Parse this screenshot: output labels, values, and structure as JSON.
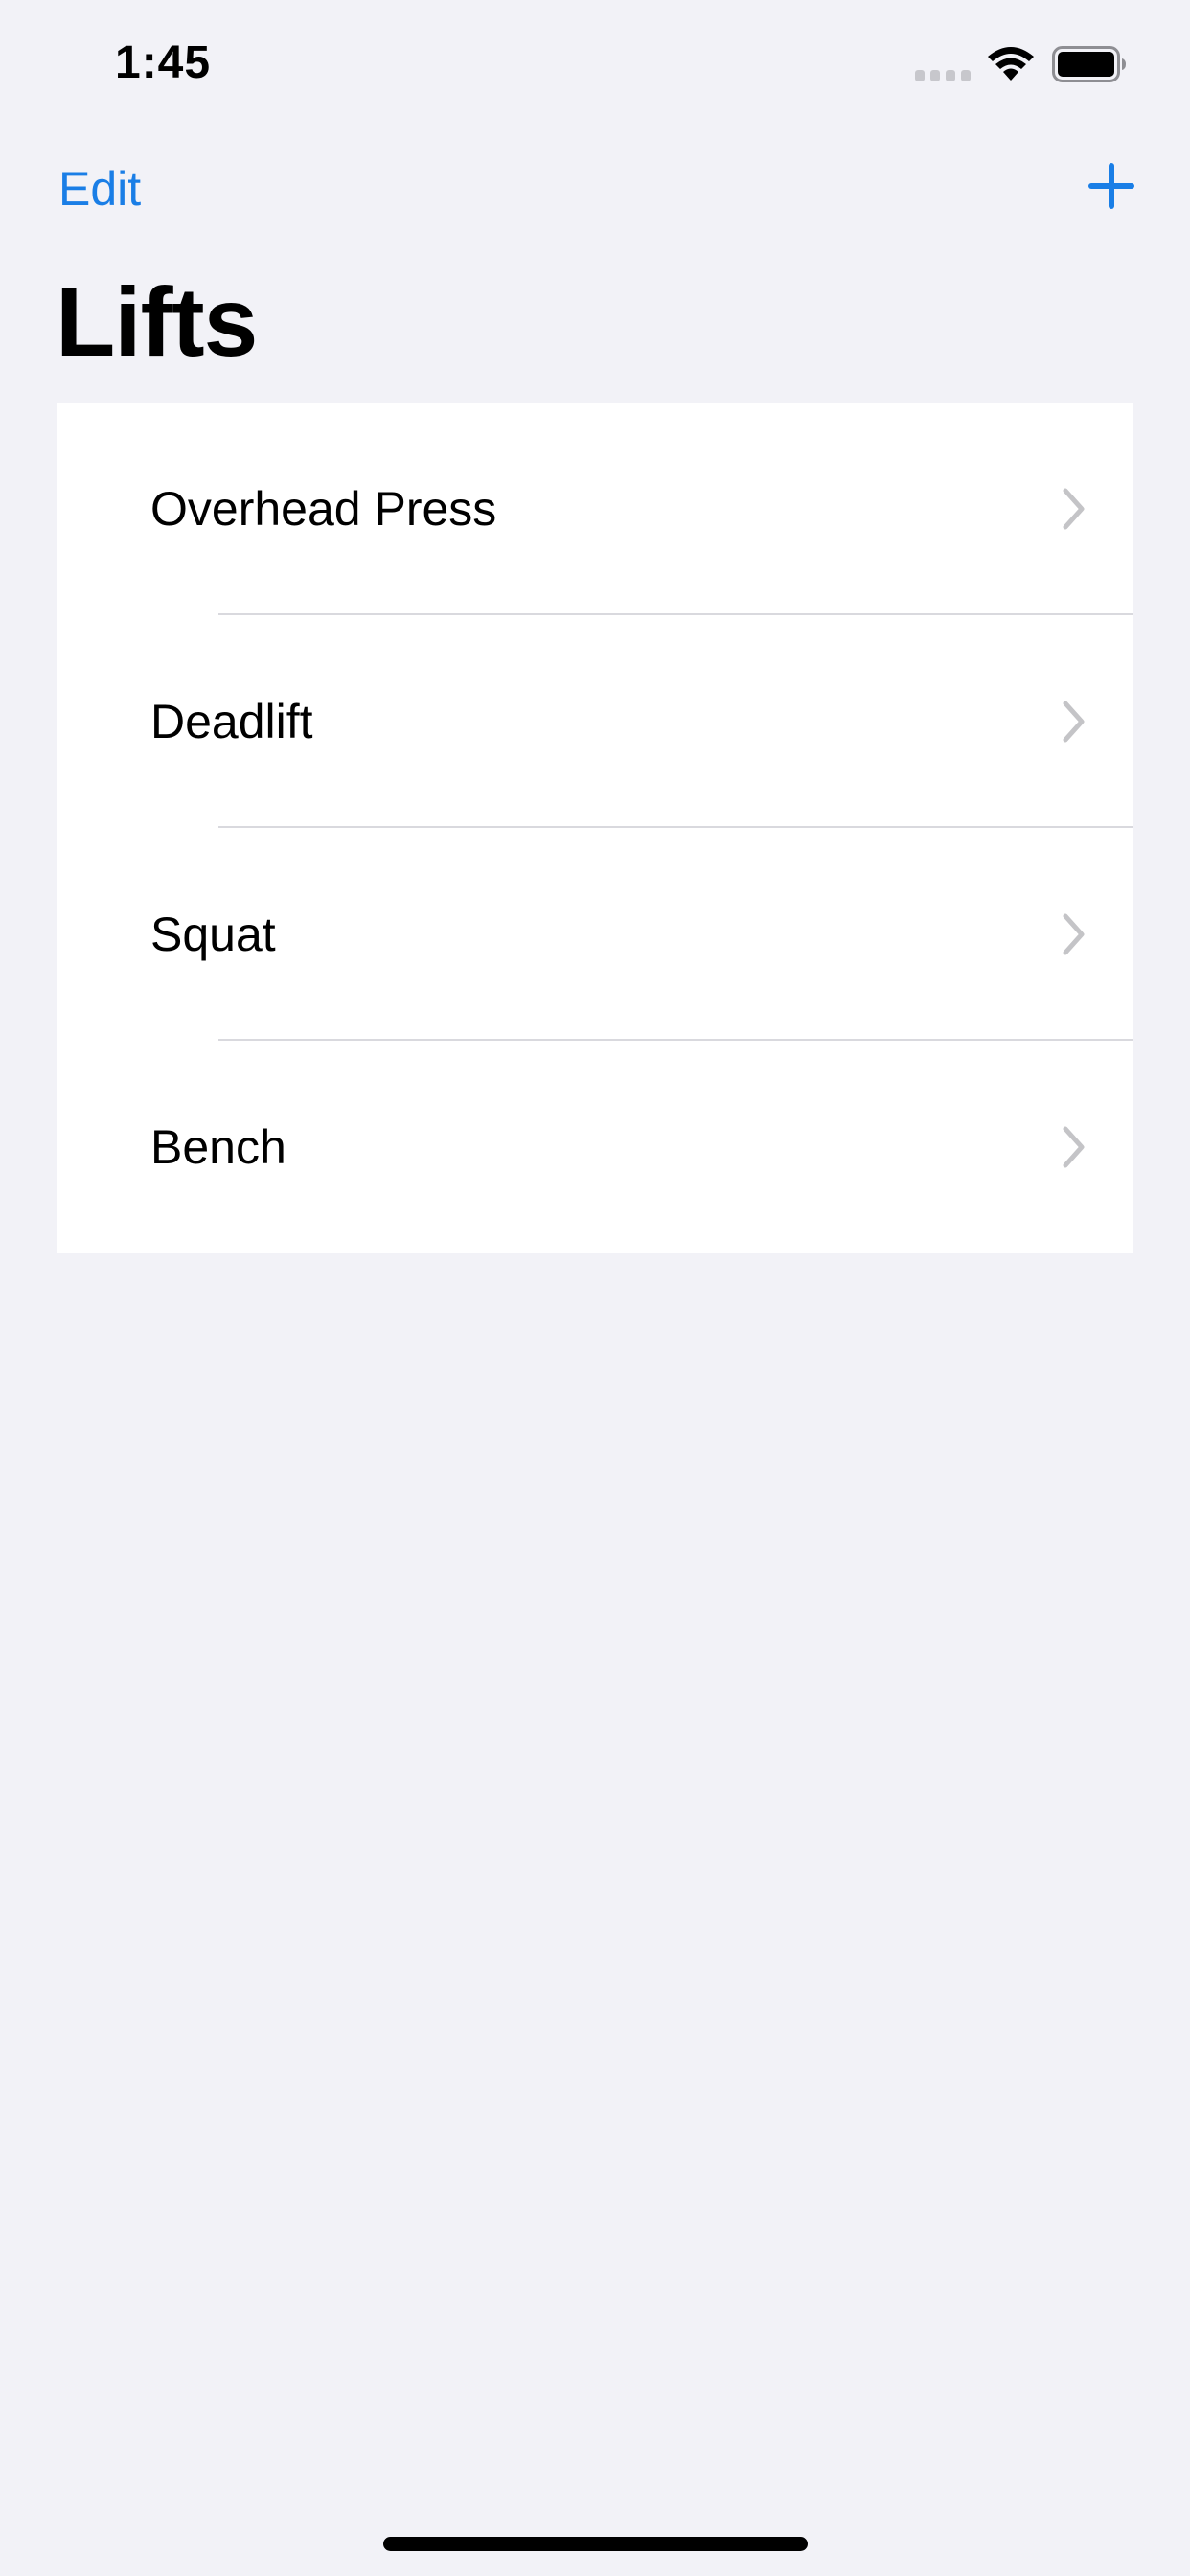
{
  "status_bar": {
    "time": "1:45",
    "icons": [
      "cellular-signal-icon",
      "wifi-icon",
      "battery-icon"
    ]
  },
  "nav": {
    "edit_label": "Edit",
    "add_icon": "plus-icon",
    "title": "Lifts"
  },
  "lifts": {
    "items": [
      {
        "label": "Overhead Press"
      },
      {
        "label": "Deadlift"
      },
      {
        "label": "Squat"
      },
      {
        "label": "Bench"
      }
    ],
    "chevron_icon": "chevron-right-icon"
  },
  "colors": {
    "accent": "#1a7ee6",
    "background": "#f2f2f7",
    "list_background": "#ffffff",
    "separator": "#d9d9de",
    "chevron": "#c4c4c7"
  }
}
